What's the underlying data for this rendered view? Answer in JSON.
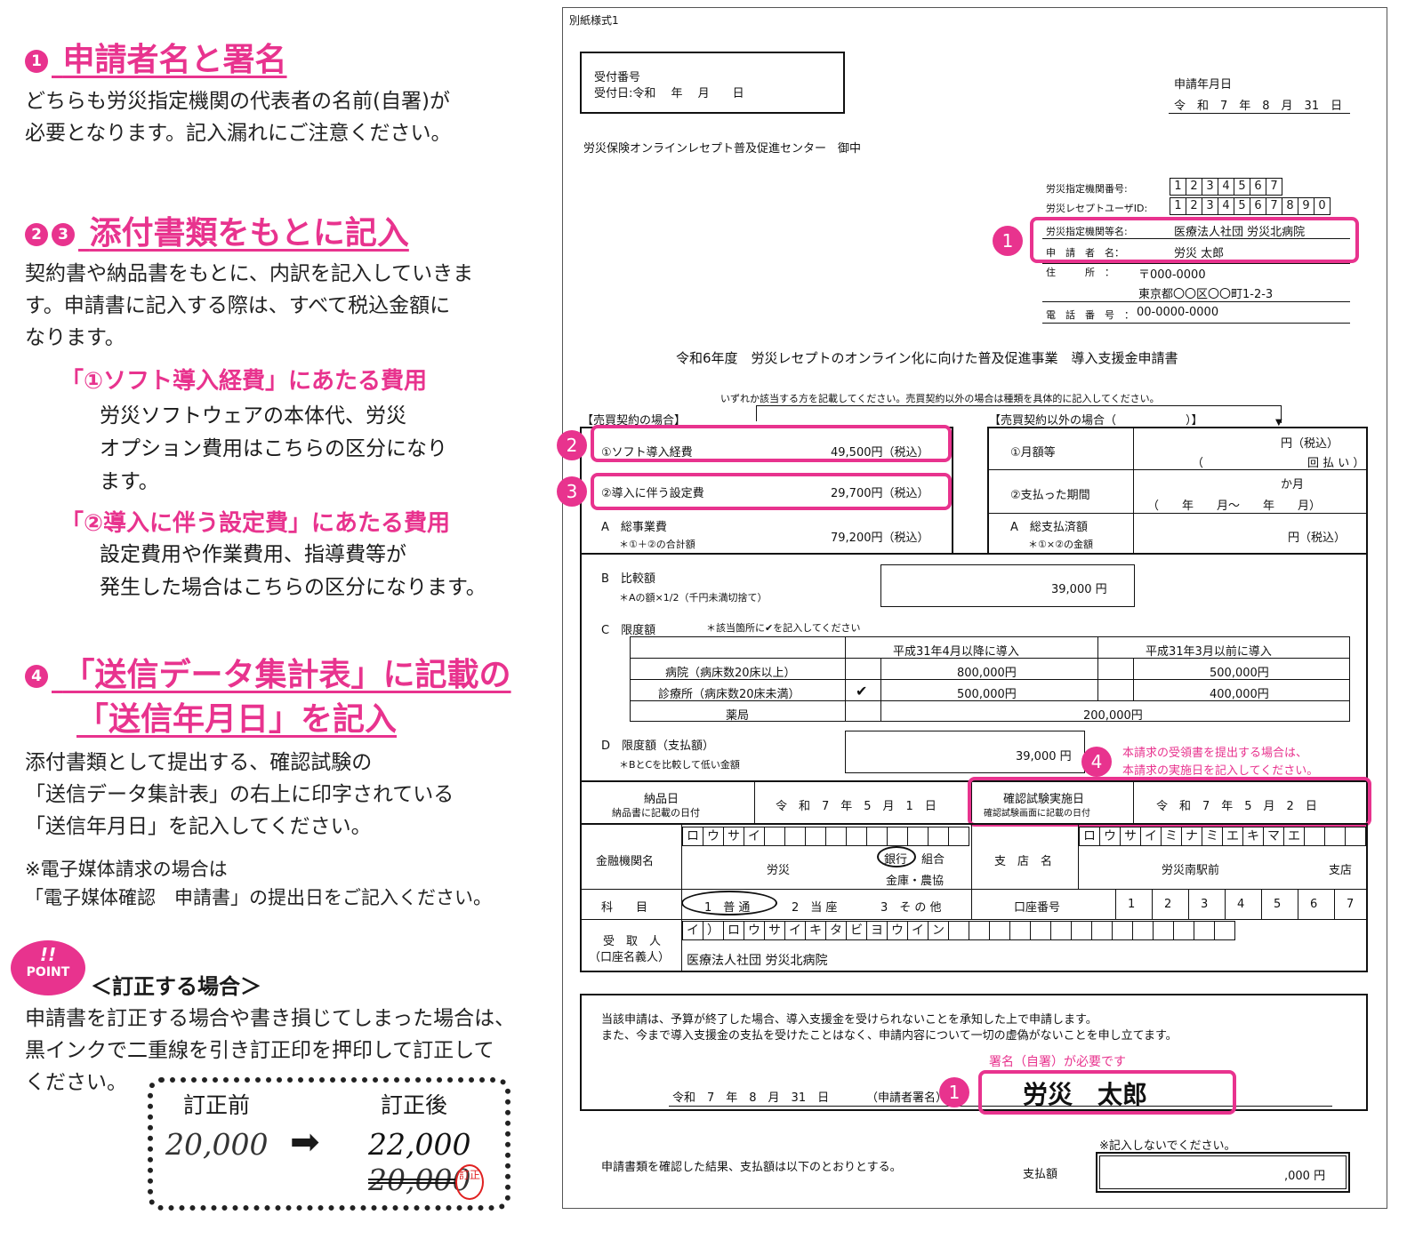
{
  "left": {
    "s1": {
      "num": "1",
      "title": "申請者名と署名",
      "body1": "どちらも労災指定機関の代表者の名前(自署)が",
      "body2": "必要となります。記入漏れにご注意ください。"
    },
    "s23": {
      "num1": "2",
      "num2": "3",
      "title": "添付書類をもとに記入",
      "body1": "契約書や納品書をもとに、内訳を記入していきま",
      "body2": "す。申請書に記入する際は、すべて税込金額に",
      "body3": "なります。",
      "sub1_head": "「①ソフト導入経費」にあたる費用",
      "sub1_l1": "労災ソフトウェアの本体代、労災",
      "sub1_l2": "オプション費用はこちらの区分になり",
      "sub1_l3": "ます。",
      "sub2_head": "「②導入に伴う設定費」にあたる費用",
      "sub2_l1": "設定費用や作業費用、指導費等が",
      "sub2_l2": "発生した場合はこちらの区分になります。"
    },
    "s4": {
      "num": "4",
      "title1": "「送信データ集計表」に記載の",
      "title2": "「送信年月日」を記入",
      "body1": "添付書類として提出する、確認試験の",
      "body2": "「送信データ集計表」の右上に印字されている",
      "body3": "「送信年月日」を記入してください。",
      "note1": "※電子媒体請求の場合は",
      "note2": "「電子媒体確認　申請書」の提出日をご記入ください。"
    },
    "point": {
      "bang": "!!",
      "label": "POINT",
      "head": "＜訂正する場合＞",
      "body1": "申請書を訂正する場合や書き損じてしまった場合は、",
      "body2": "黒インクで二重線を引き訂正印を押印して訂正して",
      "body3": "ください。",
      "before_label": "訂正前",
      "after_label": "訂正後",
      "before_val": "20,000",
      "after_new": "22,000",
      "after_old": "20,000",
      "seal": "訂正",
      "arrow": "➡"
    }
  },
  "form": {
    "form_id": "別紙様式1",
    "receipt_no": "受付番号",
    "receipt_date": "受付日:令和　 年　 月　　日",
    "apply_date_label": "申請年月日",
    "apply_date": "令　和　7　年　8　月　31　日",
    "addressee": "労災保険オンラインレセプト普及促進センター　御中",
    "inst_no_label": "労災指定機関番号:",
    "inst_no": [
      "1",
      "2",
      "3",
      "4",
      "5",
      "6",
      "7"
    ],
    "user_id_label": "労災レセプトユーザID:",
    "user_id": [
      "1",
      "2",
      "3",
      "4",
      "5",
      "6",
      "7",
      "8",
      "9",
      "0"
    ],
    "inst_name_label": "労災指定機関等名:",
    "inst_name": "医療法人社団 労災北病院",
    "applicant_label": "申　請　者　名：",
    "applicant": "労災 太郎",
    "addr_label": "住　　　所　：",
    "zip": "〒000-0000",
    "addr": "東京都〇〇区〇〇町1-2-3",
    "tel_label": "電　話　番　号　：",
    "tel": "00-0000-0000",
    "doc_title": "令和6年度　労災レセプトのオンライン化に向けた普及促進事業　導入支援金申請書",
    "instruction": "いずれか該当する方を記載してください。売買契約以外の場合は種類を具体的に記入してください。",
    "sale_head": "【売買契約の場合】",
    "other_head": "【売買契約以外の場合（　　　　　　）】",
    "soft_label": "①ソフト導入経費",
    "soft_val": "49,500円（税込）",
    "setup_label": "②導入に伴う設定費",
    "setup_val": "29,700円（税込）",
    "total_label": "A　総事業費",
    "total_note": "＊①＋②の合計額",
    "total_val": "79,200円（税込）",
    "monthly_label": "①月額等",
    "monthly_unit": "円（税込）",
    "monthly_pay": "（　　　　　　　　　回 払 い ）",
    "period_label": "②支払った期間",
    "period_unit": "か月",
    "period_range": "（　　年　　月〜　　年　　月）",
    "paid_label": "A　総支払済額",
    "paid_note": "＊①×②の金額",
    "paid_unit": "円（税込）",
    "cmp_label": "B　比較額",
    "cmp_note": "＊Aの額×1/2（千円未満切捨て）",
    "cmp_val": "39,000 円",
    "limit_label": "C　限度額",
    "limit_note": "＊該当箇所に✔を記入してください",
    "lim_col1": "平成31年4月以降に導入",
    "lim_col2": "平成31年3月以前に導入",
    "lim_r1": "病院（病床数20床以上）",
    "lim_r1a": "800,000円",
    "lim_r1b": "500,000円",
    "lim_r2": "診療所（病床数20床未満）",
    "lim_r2_check": "✔",
    "lim_r2a": "500,000円",
    "lim_r2b": "400,000円",
    "lim_r3": "薬局",
    "lim_r3a": "200,000円",
    "pay_label": "D　限度額（支払額）",
    "pay_note": "＊BとCを比較して低い金額",
    "pay_val": "39,000 円",
    "note4a": "本請求の受領書を提出する場合は、",
    "note4b": "本請求の実施日を記入してください。",
    "deliv_label": "納品日",
    "deliv_note": "納品書に記載の日付",
    "deliv_date": "令　和　7　年　5　月　1　日",
    "test_label": "確認試験実施日",
    "test_note": "確認試験画面に記載の日付",
    "test_date": "令　和　7　年　5　月　2　日",
    "bank_label": "金融機関名",
    "bank_kana": [
      "ロ",
      "ウ",
      "サ",
      "イ",
      "",
      "",
      "",
      "",
      "",
      "",
      "",
      "",
      "",
      ""
    ],
    "bank_name": "労災",
    "bank_type1": "銀行",
    "bank_type2": "組合",
    "bank_type3": "金庫・農協",
    "branch_label": "支　店　名",
    "branch_kana": [
      "ロ",
      "ウ",
      "サ",
      "イ",
      "ミ",
      "ナ",
      "ミ",
      "エ",
      "キ",
      "マ",
      "エ",
      "",
      "",
      ""
    ],
    "branch_name": "労災南駅前",
    "branch_suffix": "支店",
    "acct_type_label": "科　　目",
    "acct_type1": "1　普 通",
    "acct_type2": "2　当 座",
    "acct_type3": "3　そ の 他",
    "acct_no_label": "口座番号",
    "acct_no": [
      "1",
      "2",
      "3",
      "4",
      "5",
      "6",
      "7"
    ],
    "holder_label1": "受　取　人",
    "holder_label2": "（口座名義人）",
    "holder_kana": [
      "イ",
      "）",
      "ロ",
      "ウ",
      "サ",
      "イ",
      "キ",
      "タ",
      "ビ",
      "ヨ",
      "ウ",
      "イ",
      "ン",
      "",
      "",
      "",
      "",
      "",
      "",
      "",
      "",
      "",
      "",
      "",
      "",
      "",
      ""
    ],
    "holder_name": "医療法人社団 労災北病院",
    "decl1": "当該申請は、予算が終了した場合、導入支援金を受けられないことを承知した上で申請します。",
    "decl2": "また、今まで導入支援金の支払を受けたことはなく、申請内容について一切の虚偽がないことを申し立てます。",
    "sign_note": "署名（自署）が必要です",
    "sign_date": "令和　7　年　8　月　31　日",
    "sign_label": "（申請者署名）",
    "signature": "労災　太郎",
    "no_write": "※記入しないでください。",
    "result_text": "申請書類を確認した結果、支払額は以下のとおりとする。",
    "pay_amt_label": "支払額",
    "pay_amt": ",000 円",
    "c1": "1",
    "c2": "2",
    "c3": "3",
    "c4": "4"
  }
}
